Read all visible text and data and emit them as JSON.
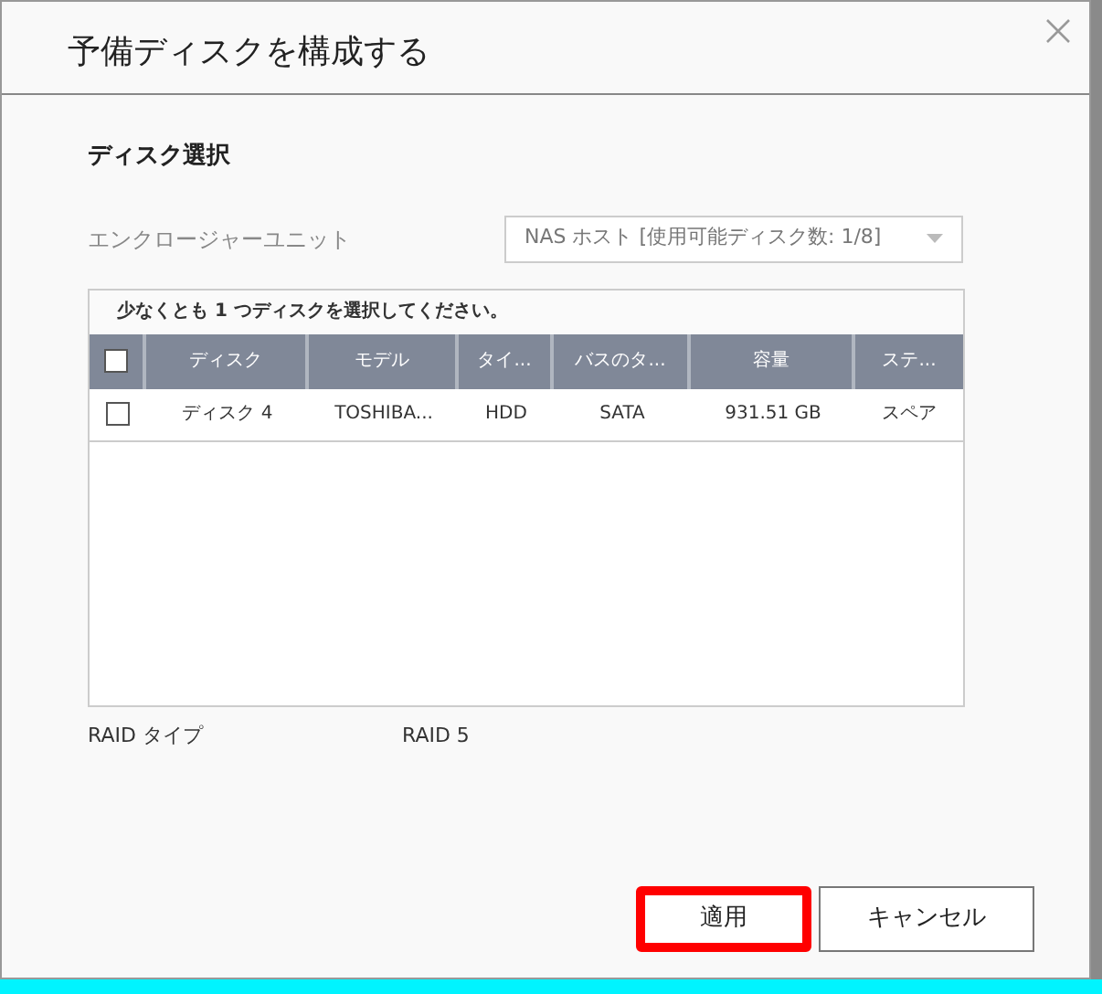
{
  "dialog": {
    "title": "予備ディスクを構成する"
  },
  "section_title": "ディスク選択",
  "enclosure": {
    "label": "エンクロージャーユニット",
    "value": "NAS ホスト [使用可能ディスク数: 1/8]"
  },
  "table": {
    "instruction": "少なくとも 1 つディスクを選択してください。",
    "header_checked": false,
    "columns": [
      "ディスク",
      "モデル",
      "タイ...",
      "バスのタ...",
      "容量",
      "ステ..."
    ],
    "rows": [
      {
        "checked": false,
        "cells": [
          "ディスク 4",
          "TOSHIBA...",
          "HDD",
          "SATA",
          "931.51 GB",
          "スペア"
        ]
      }
    ]
  },
  "raid": {
    "label": "RAID タイプ",
    "value": "RAID 5"
  },
  "buttons": [
    {
      "label": "適用",
      "highlighted": true
    },
    {
      "label": "キャンセル",
      "highlighted": false
    }
  ]
}
